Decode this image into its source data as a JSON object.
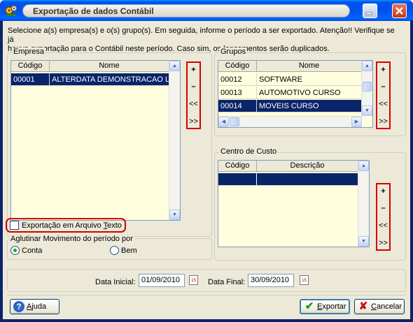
{
  "window": {
    "title": "Exportação de dados Contábil",
    "minimize_glyph": "_",
    "close_glyph": "✕"
  },
  "intro": {
    "line1": "Selecione a(s) empresa(s) e o(s) grupo(s). Em seguida, informe o período a ser exportado. Atenção!! Verifique se já",
    "line2": "houve exportação para o Contábil neste  período. Caso sim, os lançamentos serão duplicados."
  },
  "empresa": {
    "label": "Empresa",
    "columns": [
      "Código",
      "Nome"
    ],
    "rows": [
      {
        "codigo": "00001",
        "nome": "ALTERDATA DEMONSTRACAO L",
        "selected": true
      }
    ]
  },
  "grupos": {
    "label": "Grupos",
    "columns": [
      "Código",
      "Nome"
    ],
    "rows": [
      {
        "codigo": "00012",
        "nome": "SOFTWARE",
        "selected": false
      },
      {
        "codigo": "00013",
        "nome": "AUTOMOTIVO CURSO",
        "selected": false
      },
      {
        "codigo": "00014",
        "nome": "MOVEIS CURSO",
        "selected": true
      }
    ]
  },
  "centro_custo": {
    "label": "Centro de Custo",
    "columns": [
      "Código",
      "Descrição"
    ]
  },
  "side_buttons": {
    "add": "+",
    "remove": "–",
    "prev": "<<",
    "next": ">>"
  },
  "export_text": {
    "label_pre": "Exportação em Arquivo ",
    "label_accel": "T",
    "label_post": "exto",
    "checked": false
  },
  "aglutinar": {
    "label": "Aglutinar Movimento do período por",
    "options": [
      "Conta",
      "Bem"
    ],
    "selected": "Conta"
  },
  "periodo": {
    "data_inicial_label": "Data Inicial:",
    "data_inicial": "01/09/2010",
    "data_final_label": "Data Final:",
    "data_final": "30/09/2010",
    "calendar_glyph": "15"
  },
  "footer": {
    "ajuda_accel": "A",
    "ajuda_rest": "juda",
    "exportar_accel": "E",
    "exportar_rest": "xportar",
    "cancelar_accel": "C",
    "cancelar_rest": "ancelar"
  },
  "colors": {
    "selection": "#0a246a",
    "grid_bg": "#ffffdf",
    "highlight": "#d40000"
  }
}
